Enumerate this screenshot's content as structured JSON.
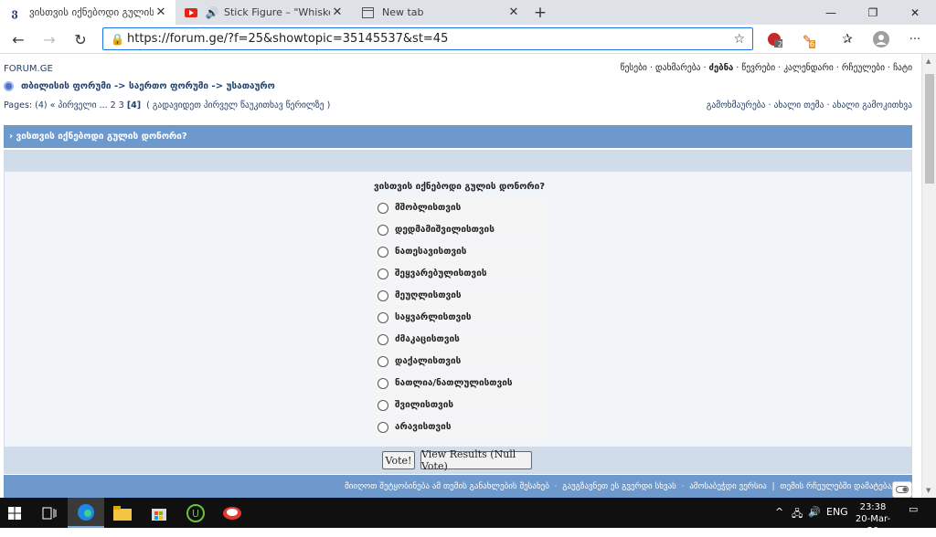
{
  "browser": {
    "tabs": [
      {
        "label": "ვისთვის იქნებოდი გულის დ",
        "icon": "forum-favicon",
        "active": true
      },
      {
        "label": "Stick Figure – \"Whiskey Sun",
        "icon": "youtube-icon",
        "active": false
      },
      {
        "label": "New tab",
        "icon": "newtab-icon",
        "active": false
      }
    ],
    "new_tab": "+",
    "url": "https://forum.ge/?f=25&showtopic=35145537&st=45",
    "badges": {
      "ext1": "2",
      "ext2": "6"
    }
  },
  "page": {
    "logo": "FORUM.GE",
    "topnav": [
      {
        "label": "წესები",
        "bold": false
      },
      {
        "label": "დახმარება",
        "bold": false
      },
      {
        "label": "ძებნა",
        "bold": true
      },
      {
        "label": "წევრები",
        "bold": false
      },
      {
        "label": "კალენდარი",
        "bold": false
      },
      {
        "label": "რჩეულები",
        "bold": false
      },
      {
        "label": "ჩატი",
        "bold": false
      }
    ],
    "breadcrumb": "თბილისის ფორუმი -> საერთო ფორუმი -> უსათაურო",
    "pages": {
      "prefix": "Pages: (4)",
      "first": "« პირველი",
      "ellipsis": "...",
      "p2": "2",
      "p3": "3",
      "current": "[4]",
      "goto": "( გადავიდეთ პირველ წაუკითხავ წერილზე )"
    },
    "actions": [
      "გამოხმაურება",
      "ახალი თემა",
      "ახალი გამოკითხვა"
    ],
    "topic_title": "› ვისთვის იქნებოდი გულის დონორი?",
    "poll": {
      "question": "ვისთვის იქნებოდი გულის დონორი?",
      "options": [
        "მშობლისთვის",
        "დედმამიშვილისთვის",
        "ნათესავისთვის",
        "შეყვარებულისთვის",
        "მეუღლისთვის",
        "საყვარლისთვის",
        "ძმაკაცისთვის",
        "დაქალისთვის",
        "ნათლია/ნათლულისთვის",
        "შვილისთვის",
        "არავისთვის"
      ],
      "vote_button": "Vote!",
      "results_button": "View Results (Null Vote)"
    },
    "footer": [
      "მიიღოთ შეტყობინება ამ თემის განახლების შესახებ",
      "გაუგზავნეთ ეს გვერდი სხვას",
      "ამოსაბეჭდი ვერსია",
      "თემის რჩეულებში დამატება/წაშ"
    ]
  },
  "taskbar": {
    "language": "ENG",
    "time": "23:38",
    "date": "20-Mar-20"
  }
}
